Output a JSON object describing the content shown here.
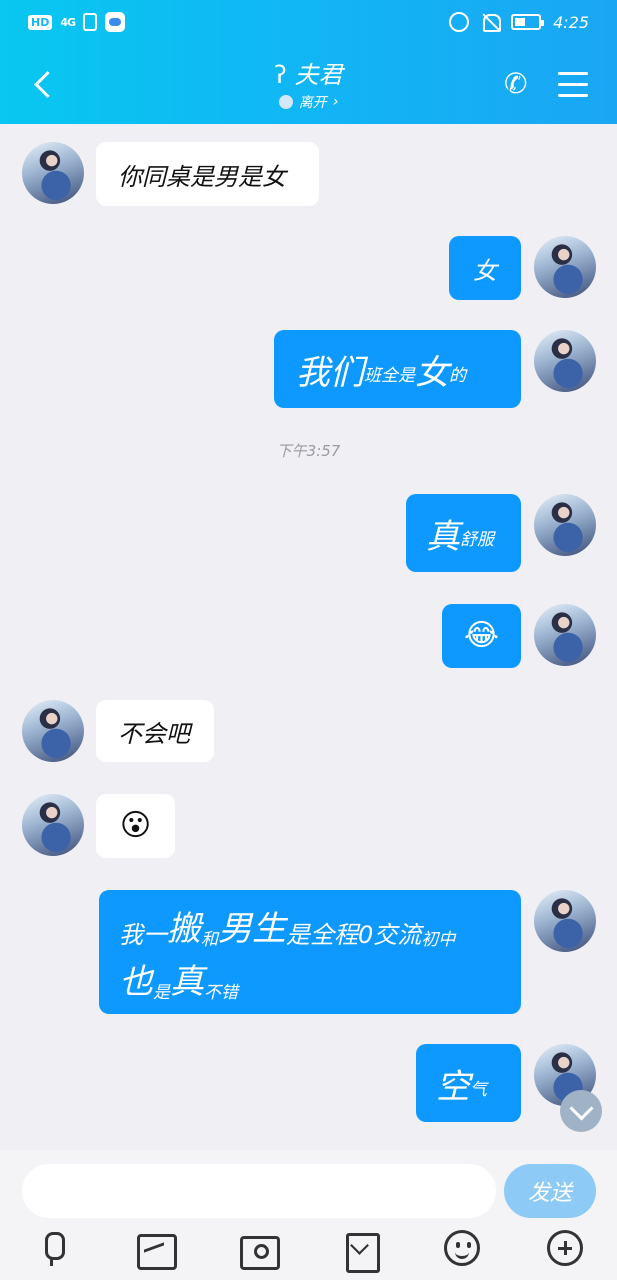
{
  "status_bar": {
    "hd": "HD",
    "network": "4G",
    "time": "4:25"
  },
  "header": {
    "title": "夫君",
    "status": "离开",
    "status_chevron": "›"
  },
  "messages": [
    {
      "side": "in",
      "parts": [
        "你同桌是男是女"
      ]
    },
    {
      "side": "out",
      "parts": [
        "女"
      ]
    },
    {
      "side": "out",
      "parts": [
        "我们",
        "班全是",
        "女",
        "的"
      ]
    },
    {
      "side": "out",
      "parts": [
        "真",
        "舒服"
      ]
    },
    {
      "side": "out",
      "parts": [
        "😂"
      ]
    },
    {
      "side": "in",
      "parts": [
        "不会吧"
      ]
    },
    {
      "side": "in",
      "parts": [
        "😮"
      ]
    },
    {
      "side": "out",
      "parts": [
        "我一",
        "搬",
        "和",
        "男生",
        "是全程0交流",
        "初中",
        "也",
        "是",
        "真",
        "不错"
      ]
    },
    {
      "side": "out",
      "parts": [
        "空",
        "气"
      ]
    }
  ],
  "timestamp": "下午3:57",
  "input": {
    "placeholder": "",
    "send_label": "发送"
  },
  "icons": {
    "back": "back-arrow-icon",
    "ear": "ear-icon",
    "phone": "phone-icon",
    "menu": "menu-icon",
    "scroll_down": "chevron-down-icon",
    "toolbar": [
      "microphone-icon",
      "image-icon",
      "camera-icon",
      "red-packet-icon",
      "emoji-icon",
      "plus-icon"
    ]
  },
  "colors": {
    "header_start": "#08c7f0",
    "header_end": "#1aa6f3",
    "outgoing_bubble": "#0d99ff",
    "incoming_bubble": "#ffffff",
    "send_button": "#8dcaf5",
    "background": "#efeff4"
  }
}
